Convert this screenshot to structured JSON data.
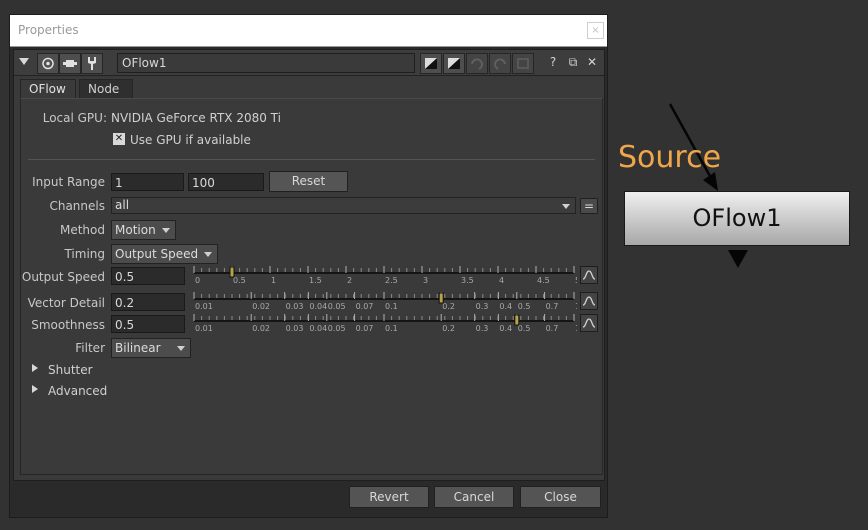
{
  "window": {
    "title": "Properties",
    "close_glyph": "×"
  },
  "toolbar": {
    "node_name": "OFlow1",
    "right_icons": [
      "?",
      "⧉",
      "✕"
    ]
  },
  "tabs": [
    {
      "label": "OFlow"
    },
    {
      "label": "Node"
    }
  ],
  "gpu": {
    "label": "Local GPU:",
    "value": "NVIDIA GeForce RTX 2080 Ti",
    "use_gpu_label": "Use GPU if available",
    "use_gpu_checked": true
  },
  "input_range": {
    "label": "Input Range",
    "start": "1",
    "end": "100",
    "reset_label": "Reset"
  },
  "channels": {
    "label": "Channels",
    "value": "all",
    "eq_label": "="
  },
  "method": {
    "label": "Method",
    "value": "Motion"
  },
  "timing": {
    "label": "Timing",
    "value": "Output Speed"
  },
  "output_speed": {
    "label": "Output Speed",
    "value": "0.5",
    "ticks": [
      "0",
      "0.5",
      "1",
      "1.5",
      "2",
      "2.5",
      "3",
      "3.5",
      "4",
      "4.5",
      "5"
    ],
    "slider_value": 0.5,
    "scale": "linear",
    "range": [
      0,
      5
    ]
  },
  "vector_detail": {
    "label": "Vector Detail",
    "value": "0.2",
    "ticks": [
      "0.01",
      "0.02",
      "0.03",
      "0.04",
      "0.05",
      "0.07",
      "0.1",
      "0.2",
      "0.3",
      "0.4",
      "0.5",
      "0.7",
      "1"
    ],
    "slider_value": 0.2,
    "scale": "log",
    "range": [
      0.01,
      1
    ]
  },
  "smoothness": {
    "label": "Smoothness",
    "value": "0.5",
    "ticks": [
      "0.01",
      "0.02",
      "0.03",
      "0.04",
      "0.05",
      "0.07",
      "0.1",
      "0.2",
      "0.3",
      "0.4",
      "0.5",
      "0.7",
      "1"
    ],
    "slider_value": 0.5,
    "scale": "log",
    "range": [
      0.01,
      1
    ]
  },
  "filter": {
    "label": "Filter",
    "value": "Bilinear"
  },
  "groups": [
    {
      "label": "Shutter"
    },
    {
      "label": "Advanced"
    }
  ],
  "footer": {
    "revert": "Revert",
    "cancel": "Cancel",
    "close": "Close"
  },
  "node_graph": {
    "source_label": "Source",
    "node_label": "OFlow1"
  },
  "colors": {
    "accent": "#f0a64a",
    "node_gradient_top": "#efefef",
    "node_gradient_bottom": "#a8a8a8",
    "background": "#323232"
  }
}
